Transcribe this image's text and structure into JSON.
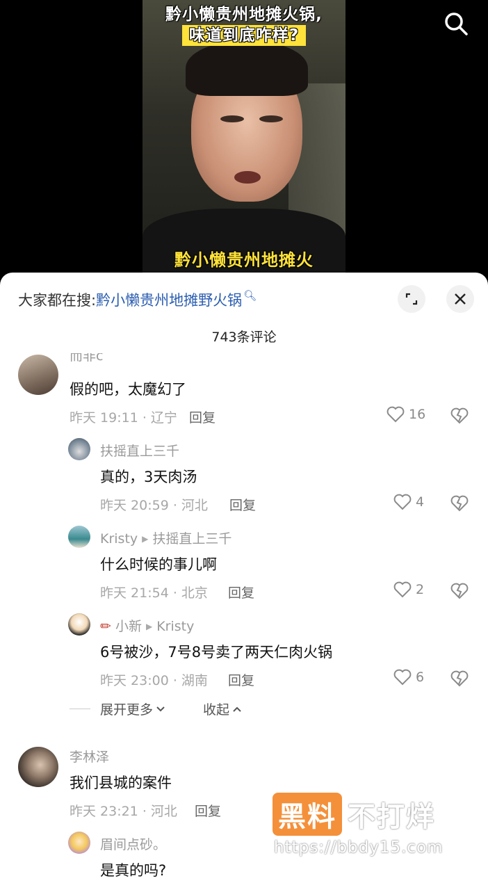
{
  "video": {
    "title_line1": "黔小懒贵州地摊火锅,",
    "title_line2": "味道到底咋样?",
    "caption": "黔小懒贵州地摊火"
  },
  "search_bar": {
    "prefix": "大家都在搜:",
    "keyword": "黔小懒贵州地摊野火锅"
  },
  "comment_count": "743条评论",
  "comments": [
    {
      "name": "而非c",
      "text": "假的吧，太魔幻了",
      "meta": "昨天 19:11 · 辽宁",
      "reply": "回复",
      "likes": "16"
    },
    {
      "name": "扶摇直上三千",
      "text": "真的，3天肉汤",
      "meta": "昨天 20:59 · 河北",
      "reply": "回复",
      "likes": "4"
    },
    {
      "name": "Kristy",
      "reply_to": "扶摇直上三千",
      "text": "什么时候的事儿啊",
      "meta": "昨天 21:54 · 北京",
      "reply": "回复",
      "likes": "2"
    },
    {
      "name": "小新",
      "reply_to": "Kristy",
      "text": "6号被沙，7号8号卖了两天仁肉火锅",
      "meta": "昨天 23:00 · 湖南",
      "reply": "回复",
      "likes": "6"
    },
    {
      "name": "李林泽",
      "text": "我们县城的案件",
      "meta": "昨天 23:21 · 河北",
      "reply": "回复"
    },
    {
      "name": "眉间点砂。",
      "text": "是真的吗?"
    }
  ],
  "expand_more": "展开更多",
  "collapse": "收起",
  "watermark": {
    "box": "黑料",
    "text": "不打烊",
    "url": "https://bbdy15.com"
  }
}
